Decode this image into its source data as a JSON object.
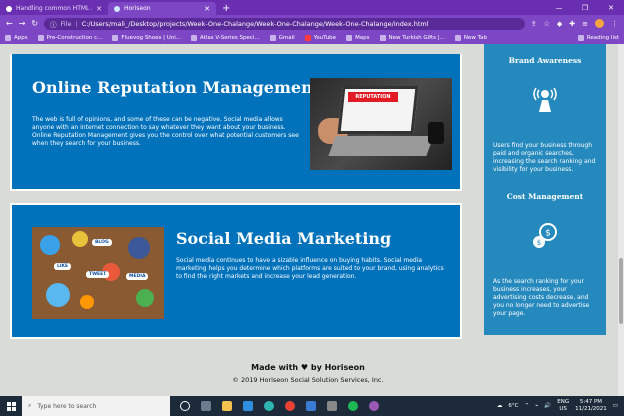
{
  "browser": {
    "tabs": [
      {
        "title": "Handling common HTML and CS",
        "active": false
      },
      {
        "title": "Horiseon",
        "active": true
      }
    ],
    "address": {
      "scheme": "File",
      "url": "C:/Users/mali_/Desktop/projects/Week-One-Chalange/Week-One-Chalange/Week-One-Chalange/index.html"
    },
    "bookmarks": [
      "Apps",
      "Pre-Construction c...",
      "Fluevog Shoes | Uni...",
      "Atlas V-Series Speci...",
      "Gmail",
      "YouTube",
      "Maps",
      "New Turkish Gifts |...",
      "New Tab"
    ],
    "reading_list": "Reading list"
  },
  "page": {
    "orm": {
      "title": "Online Reputation Management",
      "text": "The web is full of opinions, and some of these can be negative. Social media allows anyone with an internet connection to say whatever they want about your business. Online Reputation Management gives you the control over what potential customers see when they search for your business.",
      "image_banner": "REPUTATION"
    },
    "smm": {
      "title": "Social Media Marketing",
      "text": "Social media continues to have a sizable influence on buying habits. Social media marketing helps you determine which platforms are suited to your brand, using analytics to find the right markets and increase your lead generation.",
      "image_labels": [
        "BLOG",
        "TWEET",
        "MEDIA",
        "LIKE"
      ]
    },
    "sidebar": {
      "brand": {
        "title": "Brand Awareness",
        "text": "Users find your business through paid and organic searches, increasing the search ranking and visibility for your business."
      },
      "cost": {
        "title": "Cost Management",
        "text": "As the search ranking for your business increases, your advertising costs decrease, and you no longer need to advertise your page."
      }
    },
    "footer": {
      "made_with": "Made with ♥ by Horiseon",
      "copyright": "© 2019 Horiseon Social Solution Services, Inc."
    }
  },
  "taskbar": {
    "search_placeholder": "Type here to search",
    "weather": "6°C",
    "lang": "ENG",
    "region": "US",
    "time": "5:47 PM",
    "date": "11/21/2021"
  },
  "colors": {
    "card_blue": "#0072bb",
    "sidebar_blue": "#2589bd",
    "page_bg": "#d9dcd6",
    "browser_purple": "#7d46c4"
  }
}
